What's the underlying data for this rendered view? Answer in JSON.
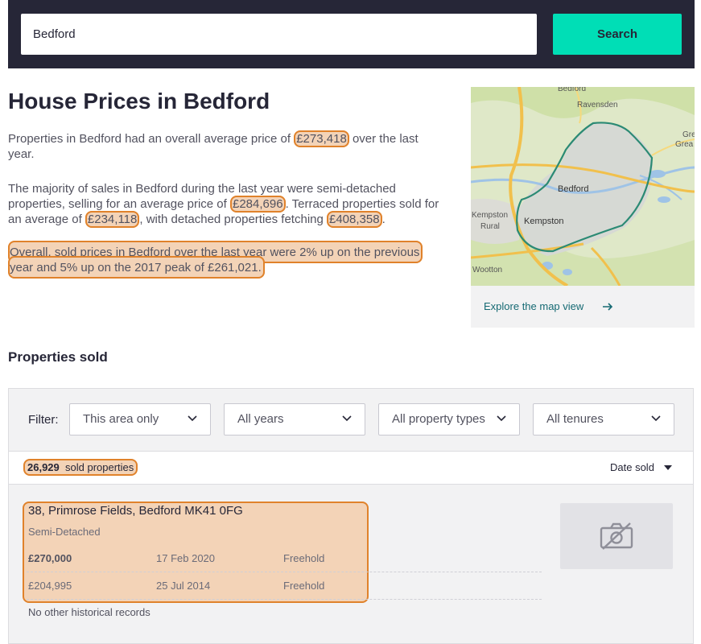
{
  "search": {
    "value": "Bedford",
    "button_label": "Search"
  },
  "intro": {
    "title": "House Prices in Bedford",
    "p1_a": "Properties in Bedford had an overall average price of ",
    "p1_price": "£273,418",
    "p1_b": " over the last year.",
    "p2_a": "The majority of sales in Bedford during the last year were semi-detached properties, selling for an average price of ",
    "p2_price_semi": "£284,696",
    "p2_b": ". Terraced properties sold for an average of ",
    "p2_price_terraced": "£234,118",
    "p2_c": ", with detached properties fetching ",
    "p2_price_detached": "£408,358",
    "p2_d": ".",
    "p3": "Overall, sold prices in Bedford over the last year were 2% up on the previous year and 5% up on the 2017 peak of £261,021."
  },
  "map": {
    "labels": [
      "Bedford",
      "Ravensden",
      "Gre",
      "Grea",
      "Bedford",
      "Kempston",
      "Kempston",
      "Rural",
      "Wootton"
    ],
    "link_label": "Explore the map view",
    "arrow_icon": "arrow-right-icon"
  },
  "sold": {
    "heading": "Properties sold",
    "filter_label": "Filter:",
    "filters": [
      {
        "label": "This area only"
      },
      {
        "label": "All years"
      },
      {
        "label": "All property types"
      },
      {
        "label": "All tenures"
      }
    ],
    "count_number": "26,929",
    "count_text": "sold properties",
    "sort_label": "Date sold",
    "listing": {
      "address": "38, Primrose Fields, Bedford MK41 0FG",
      "type": "Semi-Detached",
      "rows": [
        {
          "price": "£270,000",
          "date": "17 Feb 2020",
          "tenure": "Freehold"
        },
        {
          "price": "£204,995",
          "date": "25 Jul 2014",
          "tenure": "Freehold"
        }
      ],
      "no_records": "No other historical records",
      "photo_icon": "no-photo-icon"
    }
  },
  "colors": {
    "header_bg": "#262637",
    "search_button": "#00deb6",
    "highlight_fill": "#f3d3b7",
    "highlight_border": "#e0822b",
    "link": "#166a73"
  }
}
